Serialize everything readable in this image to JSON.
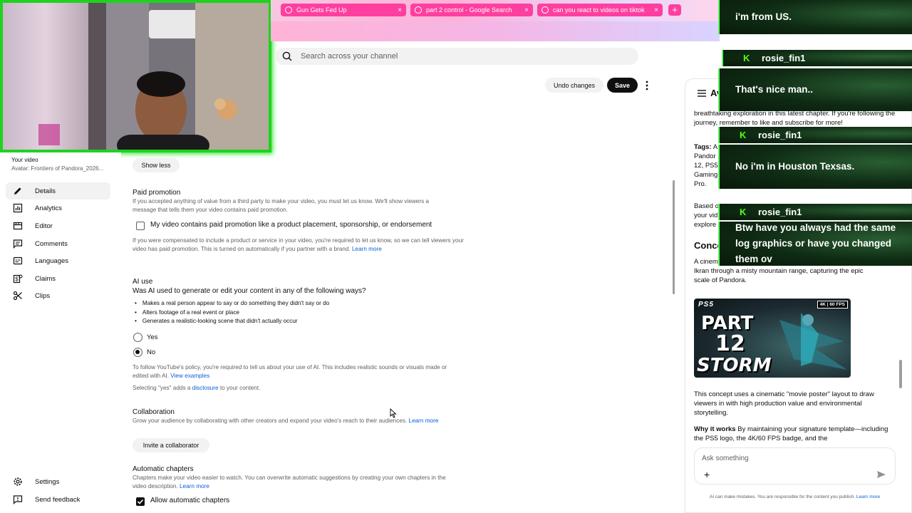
{
  "browser": {
    "tabs": [
      {
        "label": "Gun Gets Fed Up",
        "close": "×"
      },
      {
        "label": "part 2 control - Google Search",
        "close": "×"
      },
      {
        "label": "can you react to videos on tiktok",
        "close": "×"
      }
    ],
    "new_tab": "+"
  },
  "header": {
    "search_placeholder": "Search across your channel",
    "undo_label": "Undo changes",
    "save_label": "Save"
  },
  "sidebar": {
    "your_video": "Your video",
    "video_name": "Avatar: Frontiers of Pandora_2026...",
    "items": [
      {
        "label": "Details",
        "icon": "pencil-icon"
      },
      {
        "label": "Analytics",
        "icon": "analytics-icon"
      },
      {
        "label": "Editor",
        "icon": "editor-icon"
      },
      {
        "label": "Comments",
        "icon": "comments-icon"
      },
      {
        "label": "Languages",
        "icon": "languages-icon"
      },
      {
        "label": "Claims",
        "icon": "claims-icon"
      },
      {
        "label": "Clips",
        "icon": "scissors-icon"
      }
    ],
    "settings": "Settings",
    "feedback": "Send feedback"
  },
  "main": {
    "show_less": "Show less",
    "paid_promotion": {
      "title": "Paid promotion",
      "desc": "If you accepted anything of value from a third party to make your video, you must let us know. We'll show viewers a message that tells them your video contains paid promotion.",
      "checkbox_label": "My video contains paid promotion like a product placement, sponsorship, or endorsement",
      "note": "If you were compensated to include a product or service in your video, you're required to let us know, so we can tell viewers your video has paid promotion. This is turned on automatically if you partner with a brand.",
      "note_link": "Learn more"
    },
    "ai_use": {
      "title": "AI use",
      "question": "Was AI used to generate or edit your content in any of the following ways?",
      "bullets": [
        "Makes a real person appear to say or do something they didn't say or do",
        "Alters footage of a real event or place",
        "Generates a realistic-looking scene that didn't actually occur"
      ],
      "yes": "Yes",
      "no": "No",
      "selected": "No",
      "policy": "To follow YouTube's policy, you're required to tell us about your use of AI. This includes realistic sounds or visuals made or edited with AI.",
      "policy_link": "View examples",
      "selecting_pre": "Selecting \"yes\" adds a",
      "selecting_link": "disclosure",
      "selecting_post": "to your content."
    },
    "collaboration": {
      "title": "Collaboration",
      "desc": "Grow your audience by collaborating with other creators and expand your video's reach to their audiences.",
      "link": "Learn more",
      "button": "Invite a collaborator"
    },
    "chapters": {
      "title": "Automatic chapters",
      "desc": "Chapters make your video easier to watch. You can overwrite automatic suggestions by creating your own chapters in the video description.",
      "link": "Learn more",
      "checkbox_label": "Allow automatic chapters",
      "checked": true
    }
  },
  "ai_panel": {
    "title": "Av",
    "intro": "breathtaking exploration in this latest chapter. If you're following the journey, remember to like and subscribe for more!",
    "tags_label": "Tags:",
    "tags_lines": [
      "A",
      "Pandor",
      "12, PS5",
      "Gaming",
      "Pro."
    ],
    "based_lines": [
      "Based o",
      "your vid",
      "explore"
    ],
    "concept_heading": "Conce",
    "concept_lines": [
      "A cinem",
      "Ikran through a misty mountain range, capturing the epic",
      "scale of Pandora."
    ],
    "thumbnail": {
      "ps5": "PS5",
      "badge": "4K | 60 FPS",
      "part": "PART",
      "number": "12",
      "storm": "STORM"
    },
    "concept_desc": "This concept uses a cinematic \"movie poster\" layout to draw viewers in with high production value and environmental storytelling.",
    "why_label": "Why it works",
    "why_text": "By maintaining your signature template—including the PS5 logo, the 4K/60 FPS badge, and the",
    "ask_placeholder": "Ask something",
    "disclaimer": "AI can make mistakes. You are responsible for the content you publish.",
    "disclaimer_link": "Learn more"
  },
  "chat": [
    {
      "type": "msg",
      "text": "i'm from US."
    },
    {
      "type": "user",
      "name": "rosie_fin1"
    },
    {
      "type": "msg",
      "text": "That's nice man.."
    },
    {
      "type": "user",
      "name": "rosie_fin1"
    },
    {
      "type": "msg",
      "text": "No i'm in Houston Texsas."
    },
    {
      "type": "user",
      "name": "rosie_fin1"
    },
    {
      "type": "msg",
      "text": "Btw have you always had the same log graphics or have you changed them ov"
    }
  ]
}
